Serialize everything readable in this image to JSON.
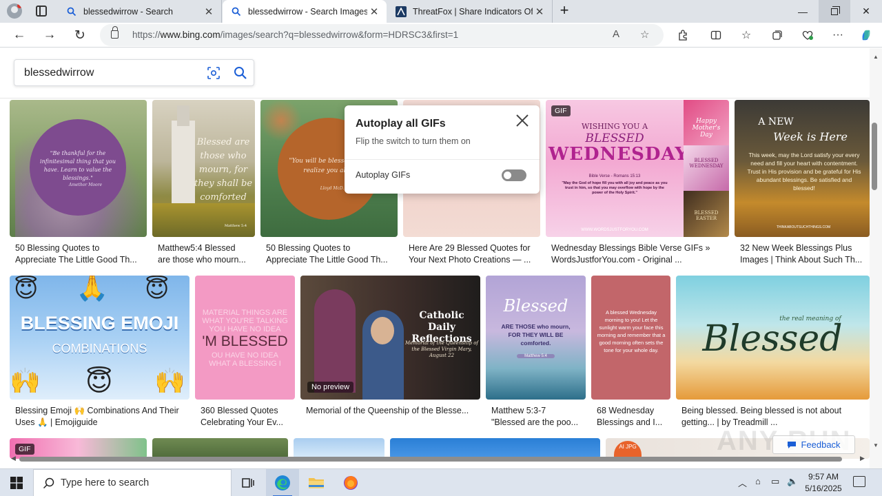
{
  "browser": {
    "tabs": [
      {
        "label": "blessedwirrow - Search",
        "icon": "bing-search-icon"
      },
      {
        "label": "blessedwirrow - Search Images",
        "icon": "bing-search-icon"
      },
      {
        "label": "ThreatFox | Share Indicators Of Compromise",
        "icon": "threatfox-icon"
      }
    ],
    "url_prefix": "https://",
    "url_host": "www.bing.com",
    "url_path": "/images/search?q=blessedwirrow&form=HDRSC3&first=1"
  },
  "search": {
    "query": "blessedwirrow"
  },
  "popup": {
    "title": "Autoplay all GIFs",
    "subtitle": "Flip the switch to turn them on",
    "toggle_label": "Autoplay GIFs"
  },
  "results": {
    "row1": [
      {
        "line1": "50 Blessing Quotes to",
        "line2": "Appreciate The Little Good Th..."
      },
      {
        "line1": "Matthew5:4 Blessed",
        "line2": "are those who mourn..."
      },
      {
        "line1": "50 Blessing Quotes to",
        "line2": "Appreciate The Little Good Th..."
      },
      {
        "line1": "Here Are 29 Blessed Quotes for",
        "line2": "Your Next Photo Creations — ..."
      },
      {
        "line1": "Wednesday Blessings Bible Verse GIFs »",
        "line2": "WordsJustforYou.com - Original ...",
        "badge": "GIF"
      },
      {
        "line1": "32 New Week Blessings Plus",
        "line2": "Images | Think About Such Th..."
      }
    ],
    "row2": [
      {
        "line1": "Blessing Emoji 🙌 Combinations And Their",
        "line2": "Uses 🙏 | Emojiguide"
      },
      {
        "line1": "360 Blessed Quotes",
        "line2": "Celebrating Your Ev..."
      },
      {
        "line1": "Memorial of the Queenship of the Blesse...",
        "line2": "",
        "overlay": "No preview"
      },
      {
        "line1": "Matthew 5:3-7",
        "line2": "\"Blessed are the poo..."
      },
      {
        "line1": "68 Wednesday",
        "line2": "Blessings and I..."
      },
      {
        "line1": "Being blessed. Being blessed is not about",
        "line2": "getting... | by Treadmill ..."
      }
    ],
    "row3_badge": "GIF",
    "row3_ai_badge": "AI JPG"
  },
  "thumb_text": {
    "t1": "\"Be thankful for the infinitesimal thing that you have. Learn to value the blessings.\"",
    "t1_author": "Amethor Moore",
    "t2": "Blessed are those who mourn, for they shall be comforted",
    "t2_ref": "Matthew 5:4",
    "t3": "\"You will be blessed t... you realize you alre...\"",
    "t3_author": "Lloyd McD...",
    "t5_a": "WISHING YOU A",
    "t5_b": "BLESSED",
    "t5_c": "WEDNESDAY",
    "t5_ref": "Bible Verse - Romans 15:13",
    "t5_verse": "\"May the God of hope fill you with all joy and peace as you trust in him, so that you may overflow with hope by the power of the Holy Spirit.\"",
    "t5_site": "WWW.WORDSJUSTFORYOU.COM",
    "t5_side1": "Happy Mother's Day",
    "t5_side2": "BLESSED WEDNESDAY",
    "t5_side3": "BLESSED EASTER",
    "t6_a": "A NEW",
    "t6_b": "Week is Here",
    "t6_body": "This week, may the Lord satisfy your every need and fill your heart with contentment. Trust in His provision and be grateful for His abundant blessings. Be satisfied and blessed!",
    "t6_site": "THINKABOUTSUCHTHINGS.COM",
    "e_a": "BLESSING EMOJI",
    "e_b": "COMBINATIONS",
    "q_line1": "MATERIAL THINGS ARE",
    "q_line2": "WHAT YOU'RE TALKING",
    "q_line3": "YOU HAVE NO IDEA",
    "q_line4": "'M BLESSED",
    "q_line5": "OU HAVE NO IDEA",
    "q_line6": "WHAT A BLESSING I",
    "c_title": "Catholic Daily Reflections",
    "c_sub": "Memorial of the Queenship of the Blessed Virgin Mary, August 22",
    "m_a": "Blessed",
    "m_b": "ARE THOSE who mourn, FOR THEY WILL BE comforted.",
    "m_ref": "Matthew 5:4",
    "w_body": "A blessed Wednesday morning to you! Let the sunlight warm your face this morning and remember that a good morning often sets the tone for your whole day.",
    "b_small": "the real meaning of",
    "b_big": "Blessed"
  },
  "feedback_label": "Feedback",
  "watermark": "ANY RUN",
  "taskbar": {
    "search_placeholder": "Type here to search",
    "time": "9:57 AM",
    "date": "5/16/2025"
  },
  "colors": {
    "bing_blue": "#1a5ed6",
    "tab_strip": "#dfe3e8",
    "taskbar": "#dde4ee"
  }
}
